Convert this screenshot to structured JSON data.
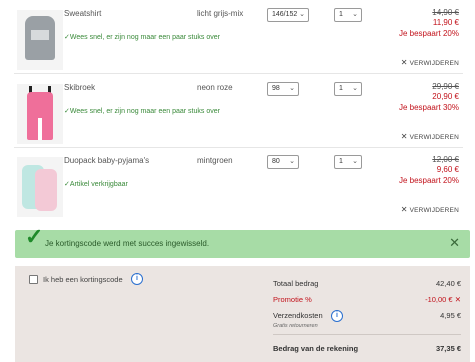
{
  "items": [
    {
      "name": "Sweatshirt",
      "stock": "Wees snel, er zijn nog maar een paar stuks over",
      "color": "licht grijs-mix",
      "size": "146/152",
      "qty": "1",
      "old_price": "14,90 €",
      "new_price": "11,90 €",
      "saving": "Je bespaart 20%",
      "remove_label": "VERWIJDEREN"
    },
    {
      "name": "Skibroek",
      "stock": "Wees snel, er zijn nog maar een paar stuks over",
      "color": "neon roze",
      "size": "98",
      "qty": "1",
      "old_price": "29,90 €",
      "new_price": "20,90 €",
      "saving": "Je bespaart 30%",
      "remove_label": "VERWIJDEREN"
    },
    {
      "name": "Duopack baby-pyjama's",
      "stock": "Artikel verkrijgbaar",
      "color": "mintgroen",
      "size": "80",
      "qty": "1",
      "old_price": "12,00 €",
      "new_price": "9,60 €",
      "saving": "Je bespaart 20%",
      "remove_label": "VERWIJDEREN"
    }
  ],
  "success_message": "Je kortingscode werd met succes ingewisseld.",
  "discount_checkbox_label": "Ik heb een kortingscode",
  "summary": {
    "total_label": "Totaal bedrag",
    "total_value": "42,40 €",
    "promo_label": "Promotie %",
    "promo_value": "-10,00 €",
    "shipping_label": "Verzendkosten",
    "shipping_value": "4,95 €",
    "returns_note": "Gratis retourneren",
    "grand_label": "Bedrag van de rekening",
    "grand_value": "37,35 €"
  },
  "colors": {
    "price_red": "#c2121b",
    "success_bg": "#a7dca6",
    "summary_bg": "#ebe5e2",
    "stock_green": "#3a8a3a",
    "info_blue": "#2a6fcf"
  },
  "icons": {
    "check": "✓",
    "close": "✕",
    "chevron": "⌄",
    "info": "i"
  }
}
